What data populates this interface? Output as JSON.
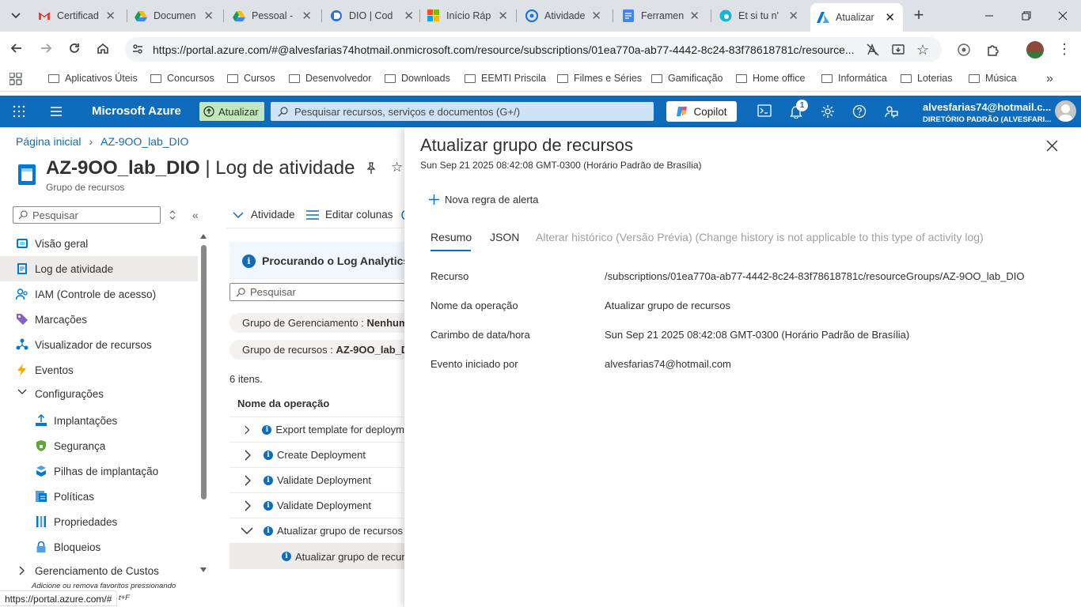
{
  "browser": {
    "tabs": [
      {
        "title": "Certificad",
        "icon": "gmail-icon"
      },
      {
        "title": "Documen",
        "icon": "google-drive-icon"
      },
      {
        "title": "Pessoal - ",
        "icon": "google-drive-icon"
      },
      {
        "title": "DIO | Cod",
        "icon": "dio-icon"
      },
      {
        "title": "Início Ráp",
        "icon": "microsoft-icon"
      },
      {
        "title": "Atividade",
        "icon": "google-classroom-icon"
      },
      {
        "title": "Ferramen",
        "icon": "google-docs-icon"
      },
      {
        "title": "Et si tu n'",
        "icon": "edge-icon"
      },
      {
        "title": "Atualizar",
        "icon": "azure-icon"
      }
    ],
    "url": "https://portal.azure.com/#@alvesfarias74hotmail.onmicrosoft.com/resource/subscriptions/01ea770a-ab77-4442-8c24-83f78618781c/resource...",
    "bookmarks": [
      "Aplicativos Úteis",
      "Concursos",
      "Cursos",
      "Desenvolvedor",
      "Downloads",
      "EEMTI Priscila",
      "Filmes e Séries",
      "Gamificação",
      "Home office",
      "Informática",
      "Loterias",
      "Música"
    ],
    "status_url": "https://portal.azure.com/#"
  },
  "azure": {
    "brand": "Microsoft Azure",
    "upgrade_label": "Atualizar",
    "search_placeholder": "Pesquisar recursos, serviços e documentos (G+/)",
    "copilot_label": "Copilot",
    "notifications_count": "1",
    "account_email": "alvesfarias74@hotmail.c...",
    "account_directory": "DIRETÓRIO PADRÃO (ALVESFARI...",
    "accent": "#0f6cbd"
  },
  "breadcrumb": [
    "Página inicial",
    "AZ-9OO_lab_DIO"
  ],
  "page": {
    "resource_name": "AZ-9OO_lab_DIO",
    "separator": "|",
    "blade_name": "Log de atividade",
    "subtitle": "Grupo de recursos"
  },
  "sidebar": {
    "search_placeholder": "Pesquisar",
    "items": [
      {
        "label": "Visão geral",
        "icon": "overview-icon"
      },
      {
        "label": "Log de atividade",
        "icon": "activity-log-icon",
        "selected": true
      },
      {
        "label": "IAM (Controle de acesso)",
        "icon": "iam-icon"
      },
      {
        "label": "Marcações",
        "icon": "tag-icon"
      },
      {
        "label": "Visualizador de recursos",
        "icon": "resource-visualizer-icon"
      },
      {
        "label": "Eventos",
        "icon": "lightning-icon"
      },
      {
        "label": "Configurações",
        "icon": "chevron-down-icon"
      },
      {
        "label": "Implantações",
        "icon": "deploy-icon"
      },
      {
        "label": "Segurança",
        "icon": "shield-icon"
      },
      {
        "label": "Pilhas de implantação",
        "icon": "stack-icon"
      },
      {
        "label": "Políticas",
        "icon": "policy-icon"
      },
      {
        "label": "Propriedades",
        "icon": "properties-icon"
      },
      {
        "label": "Bloqueios",
        "icon": "lock-icon"
      },
      {
        "label": "Gerenciamento de Custos",
        "icon": "chevron-right-icon"
      }
    ],
    "hint": "Adicione ou remova favoritos pressionando",
    "hint_suffix": "t+F"
  },
  "activity": {
    "toolbar": [
      "Atividade",
      "Editar colunas"
    ],
    "banner": "Procurando o Log Analytics?",
    "search_placeholder": "Pesquisar",
    "filters": [
      {
        "label": "Grupo de Gerenciamento :",
        "value": "Nenhum"
      },
      {
        "label": "Grupo de recursos :",
        "value": "AZ-9OO_lab_D"
      }
    ],
    "count": "6 itens.",
    "column_header": "Nome da operação",
    "rows": [
      {
        "label": "Export template for deploym",
        "expanded": false
      },
      {
        "label": "Create Deployment",
        "expanded": false
      },
      {
        "label": "Validate Deployment",
        "expanded": false
      },
      {
        "label": "Validate Deployment",
        "expanded": false
      },
      {
        "label": "Atualizar grupo de recursos",
        "expanded": true
      }
    ],
    "child_row": "Atualizar grupo de recur"
  },
  "panel": {
    "title": "Atualizar grupo de recursos",
    "timestamp": "Sun Sep 21 2025 08:42:08 GMT-0300 (Horário Padrão de Brasília)",
    "alert_rule": "Nova regra de alerta",
    "tabs": [
      "Resumo",
      "JSON",
      "Alterar histórico (Versão Prévia) (Change history is not applicable to this type of activity log)"
    ],
    "details": [
      {
        "label": "Recurso",
        "value": "/subscriptions/01ea770a-ab77-4442-8c24-83f78618781c/resourceGroups/AZ-9OO_lab_DIO"
      },
      {
        "label": "Nome da operação",
        "value": "Atualizar grupo de recursos"
      },
      {
        "label": "Carimbo de data/hora",
        "value": "Sun Sep 21 2025 08:42:08 GMT-0300 (Horário Padrão de Brasília)"
      },
      {
        "label": "Evento iniciado por",
        "value": "alvesfarias74@hotmail.com"
      }
    ]
  }
}
